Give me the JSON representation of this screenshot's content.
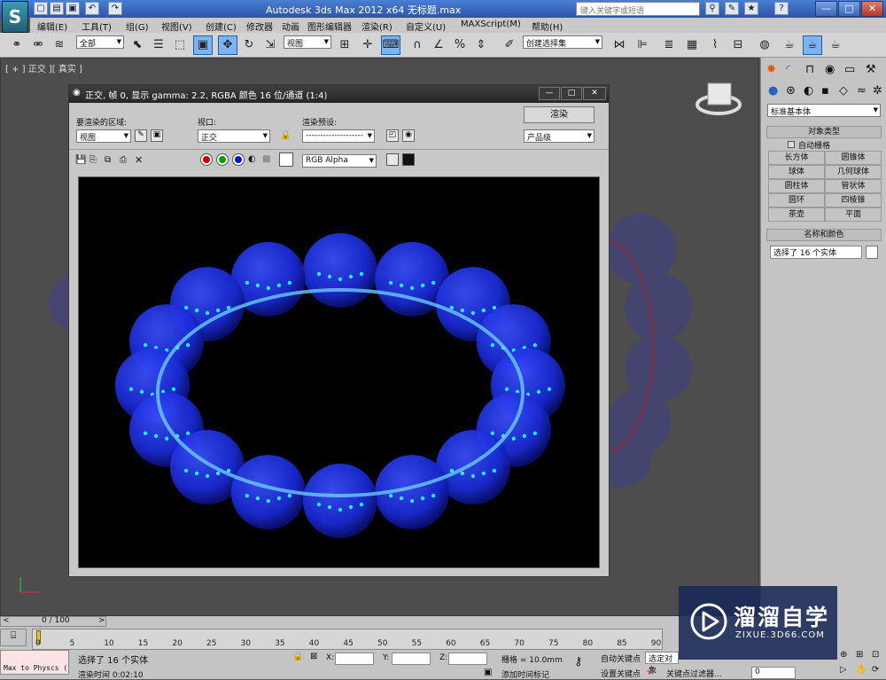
{
  "titlebar": {
    "logo": "S",
    "app_title": "Autodesk 3ds Max  2012 x64      无标题.max",
    "search_placeholder": "键入关键字或短语",
    "win_min": "—",
    "win_max": "□",
    "win_close": "✕"
  },
  "menus": [
    "编辑(E)",
    "工具(T)",
    "组(G)",
    "视图(V)",
    "创建(C)",
    "修改器",
    "动画",
    "图形编辑器",
    "渲染(R)",
    "自定义(U)",
    "MAXScript(M)",
    "帮助(H)"
  ],
  "toolbar": {
    "selection_filter": "全部",
    "ref_coord": "视图",
    "named_selection": "创建选择集"
  },
  "viewport": {
    "label": "[ + ] 正交 ][ 真实 ]"
  },
  "render_frame": {
    "title": "正交, 帧 0, 显示 gamma: 2.2, RGBA 颜色 16 位/通道 (1:4)",
    "area_label": "要渲染的区域:",
    "area_value": "视图",
    "viewport_label": "视口:",
    "viewport_value": "正交",
    "preset_label": "渲染预设:",
    "preset_value": "--------------------",
    "render_button": "渲染",
    "quality_value": "产品级",
    "channel_value": "RGB Alpha"
  },
  "command_panel": {
    "category": "标准基本体",
    "object_type_header": "对象类型",
    "autogrid": "自动栅格",
    "objects": [
      "长方体",
      "圆锥体",
      "球体",
      "几何球体",
      "圆柱体",
      "管状体",
      "圆环",
      "四棱锥",
      "茶壶",
      "平面"
    ],
    "name_color_header": "名称和颜色",
    "name_field": "选择了 16 个实体"
  },
  "timeline": {
    "frame_counter": "0 / 100",
    "ticks": [
      "0",
      "5",
      "10",
      "15",
      "20",
      "25",
      "30",
      "35",
      "40",
      "45",
      "50",
      "55",
      "60",
      "65",
      "70",
      "75",
      "80",
      "85",
      "90"
    ]
  },
  "status": {
    "maxscript": "Max to Physcs (",
    "selected": "选择了 16 个实体",
    "render_time": "渲染时间  0:02:10",
    "x_label": "X:",
    "y_label": "Y:",
    "z_label": "Z:",
    "grid": "栅格 = 10.0mm",
    "add_time_tag": "添加时间标记",
    "auto_key": "自动关键点",
    "set_key": "设置关键点",
    "selected_object": "选定对象",
    "key_filters": "关键点过滤器...",
    "frame_value": "0"
  },
  "watermark": {
    "brand": "溜溜自学",
    "url": "ZIXUE.3D66.COM"
  },
  "colors": {
    "accent": "#7cb4f0",
    "bead": "#1a2bd8",
    "bead_dots": "#27e8f5"
  }
}
